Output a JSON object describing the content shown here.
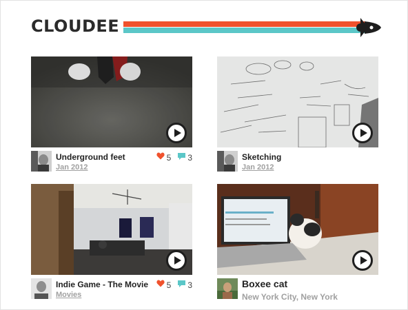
{
  "brand": {
    "name": "CLOUDEE",
    "accent_orange": "#f0522d",
    "accent_teal": "#5bc7c8"
  },
  "videos": [
    {
      "title": "Underground feet",
      "subtitle": "Jan 2012",
      "likes": "5",
      "comments": "3",
      "icon": "play-icon"
    },
    {
      "title": "Sketching",
      "subtitle": "Jan 2012",
      "icon": "play-icon"
    },
    {
      "title": "Indie Game - The Movie",
      "subtitle": "Movies",
      "likes": "5",
      "comments": "3",
      "icon": "play-icon"
    },
    {
      "title": "Boxee cat",
      "subtitle": "New York City, New York",
      "icon": "play-icon"
    }
  ]
}
